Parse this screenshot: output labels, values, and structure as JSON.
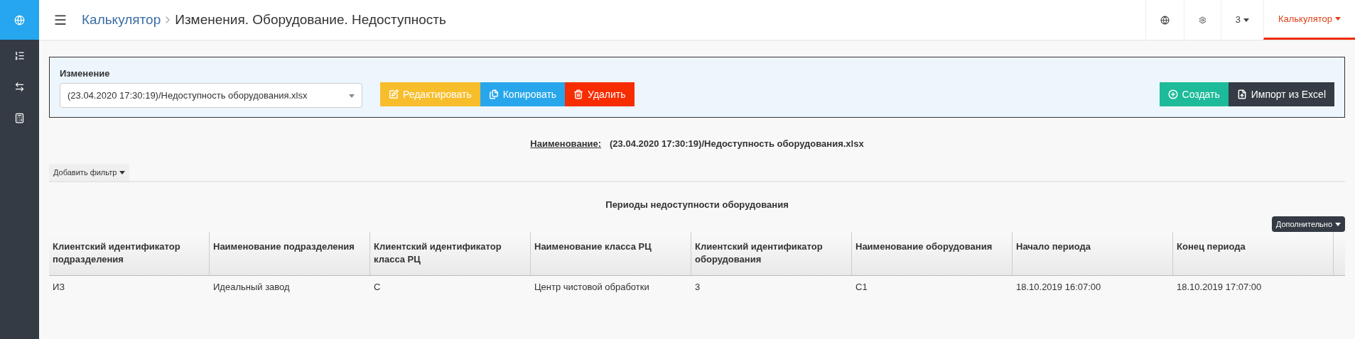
{
  "sidebar": {
    "items": [
      {
        "kind": "globe",
        "selected": true
      },
      {
        "kind": "list",
        "selected": false
      },
      {
        "kind": "exchange",
        "selected": false
      },
      {
        "kind": "calculator",
        "selected": false
      }
    ]
  },
  "header": {
    "breadcrumb": {
      "parent": "Калькулятор",
      "current": "Изменения. Оборудование. Недоступность"
    },
    "nav": [
      {
        "kind": "globe",
        "selected": false
      },
      {
        "kind": "gear",
        "selected": false
      },
      {
        "kind": "menu",
        "label": "3",
        "selected": false
      },
      {
        "kind": "menu",
        "label": "Калькулятор",
        "selected": true
      }
    ]
  },
  "change_panel": {
    "label": "Изменение",
    "select_value": "(23.04.2020 17:30:19)/Недоступность оборудования.xlsx",
    "actions": [
      {
        "kind": "edit",
        "label": "Редактировать"
      },
      {
        "kind": "copy",
        "label": "Копировать"
      },
      {
        "kind": "delete",
        "label": "Удалить"
      }
    ],
    "right_actions": [
      {
        "kind": "create",
        "label": "Создать"
      },
      {
        "kind": "import",
        "label": "Импорт из Excel"
      }
    ]
  },
  "name_line": {
    "label": "Наименование:",
    "value": "(23.04.2020 17:30:19)/Недоступность оборудования.xlsx"
  },
  "filter_button": "Добавить фильтр",
  "table": {
    "title": "Периоды недоступности оборудования",
    "more_button": "Дополнительно",
    "columns": [
      "Клиентский идентификатор подразделения",
      "Наименование подразделения",
      "Клиентский идентификатор класса РЦ",
      "Наименование класса РЦ",
      "Клиентский идентификатор оборудования",
      "Наименование оборудования",
      "Начало периода",
      "Конец периода"
    ],
    "rows": [
      [
        "ИЗ",
        "Идеальный завод",
        "С",
        "Центр чистовой обработки",
        "3",
        "С1",
        "18.10.2019 16:07:00",
        "18.10.2019 17:07:00"
      ]
    ]
  }
}
